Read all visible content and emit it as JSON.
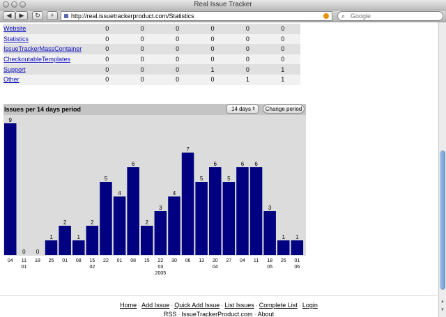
{
  "window": {
    "title": "Real Issue Tracker"
  },
  "toolbar": {
    "back_label": "◀",
    "forward_label": "▶",
    "reload_label": "↻",
    "add_label": "+",
    "url": "http://real.issuetrackerproduct.com/Statistics",
    "search_placeholder": "Google"
  },
  "stats_table": {
    "rows": [
      {
        "name": "Website",
        "values": [
          "0",
          "0",
          "0",
          "0",
          "0",
          "0"
        ]
      },
      {
        "name": "Statistics",
        "values": [
          "0",
          "0",
          "0",
          "0",
          "0",
          "0"
        ]
      },
      {
        "name": "IssueTrackerMassContainer",
        "values": [
          "0",
          "0",
          "0",
          "0",
          "0",
          "0"
        ]
      },
      {
        "name": "CheckoutableTemplates",
        "values": [
          "0",
          "0",
          "0",
          "0",
          "0",
          "0"
        ]
      },
      {
        "name": "Support",
        "values": [
          "0",
          "0",
          "0",
          "1",
          "0",
          "1"
        ]
      },
      {
        "name": "Other",
        "values": [
          "0",
          "0",
          "0",
          "0",
          "1",
          "1"
        ]
      }
    ]
  },
  "chart_panel": {
    "title": "Issues per 14 days period",
    "period_select": "14 days",
    "change_button": "Change period"
  },
  "chart_data": {
    "type": "bar",
    "title": "Issues per 14 days period",
    "categories": [
      "04",
      "11",
      "18",
      "25",
      "01",
      "08",
      "15",
      "22",
      "01",
      "08",
      "15",
      "22",
      "30",
      "06",
      "13",
      "20",
      "27",
      "04",
      "11",
      "18",
      "25",
      "01"
    ],
    "values": [
      9,
      0,
      0,
      1,
      2,
      1,
      2,
      5,
      4,
      6,
      2,
      3,
      4,
      7,
      5,
      6,
      5,
      6,
      6,
      3,
      1,
      1
    ],
    "month_labels": [
      {
        "index": 1,
        "label": "01"
      },
      {
        "index": 6,
        "label": "02"
      },
      {
        "index": 11,
        "label": "03"
      },
      {
        "index": 15,
        "label": "04"
      },
      {
        "index": 19,
        "label": "05"
      },
      {
        "index": 21,
        "label": "06"
      }
    ],
    "year_label": {
      "index": 11,
      "label": "2005"
    },
    "bar_color": "#000080",
    "ylim": [
      0,
      9
    ]
  },
  "footer": {
    "links_row1": [
      "Home",
      "Add Issue",
      "Quick Add Issue",
      "List Issues",
      "Complete List",
      "Login"
    ],
    "links_row2": [
      "RSS",
      "IssueTrackerProduct.com",
      "About"
    ],
    "separator": "·"
  }
}
